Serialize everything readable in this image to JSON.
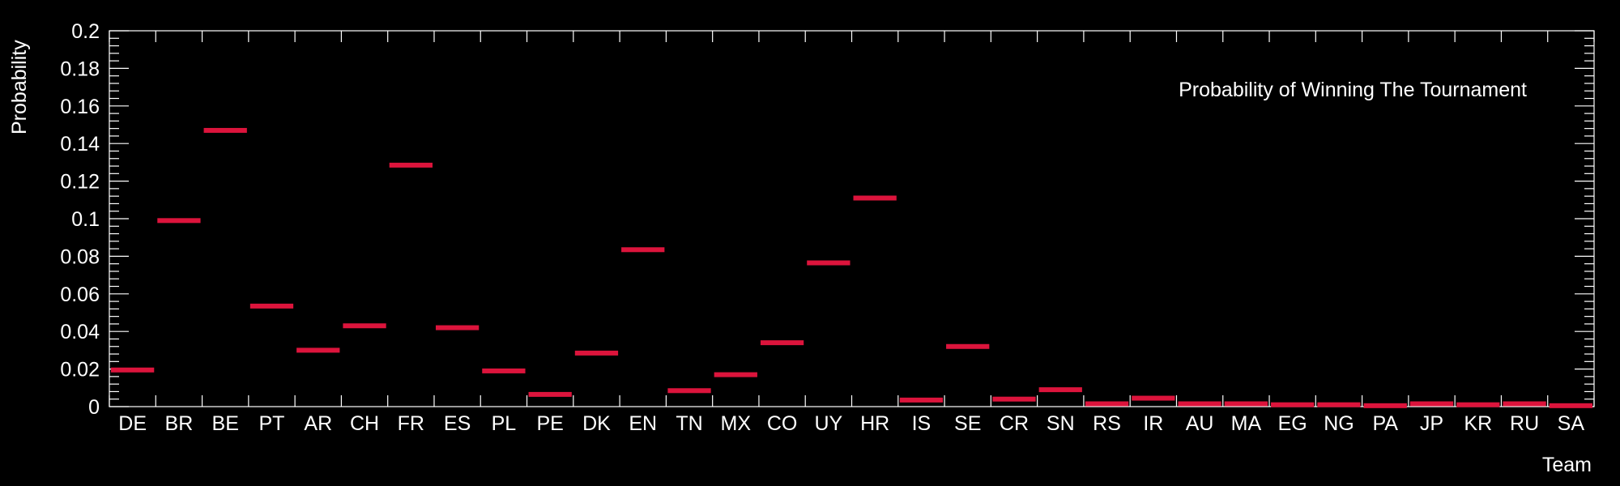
{
  "chart_data": {
    "type": "bar",
    "title": "",
    "legend": "Probability of Winning The Tournament",
    "legend_position": "top-right",
    "xlabel": "Team",
    "ylabel": "Probability",
    "ylim": [
      0,
      0.2
    ],
    "yticks": [
      "0",
      "0.02",
      "0.04",
      "0.06",
      "0.08",
      "0.1",
      "0.12",
      "0.14",
      "0.16",
      "0.18",
      "0.2"
    ],
    "grid": false,
    "marker_color": "#dc143c",
    "categories": [
      "DE",
      "BR",
      "BE",
      "PT",
      "AR",
      "CH",
      "FR",
      "ES",
      "PL",
      "PE",
      "DK",
      "EN",
      "TN",
      "MX",
      "CO",
      "UY",
      "HR",
      "IS",
      "SE",
      "CR",
      "SN",
      "RS",
      "IR",
      "AU",
      "MA",
      "EG",
      "NG",
      "PA",
      "JP",
      "KR",
      "RU",
      "SA"
    ],
    "values": [
      0.0195,
      0.099,
      0.147,
      0.0535,
      0.03,
      0.043,
      0.1285,
      0.042,
      0.019,
      0.0065,
      0.0285,
      0.0835,
      0.0085,
      0.017,
      0.034,
      0.0765,
      0.111,
      0.0035,
      0.032,
      0.004,
      0.009,
      0.0015,
      0.0045,
      0.0015,
      0.0015,
      0.001,
      0.001,
      0.0005,
      0.0015,
      0.001,
      0.0015,
      0.0005
    ]
  }
}
